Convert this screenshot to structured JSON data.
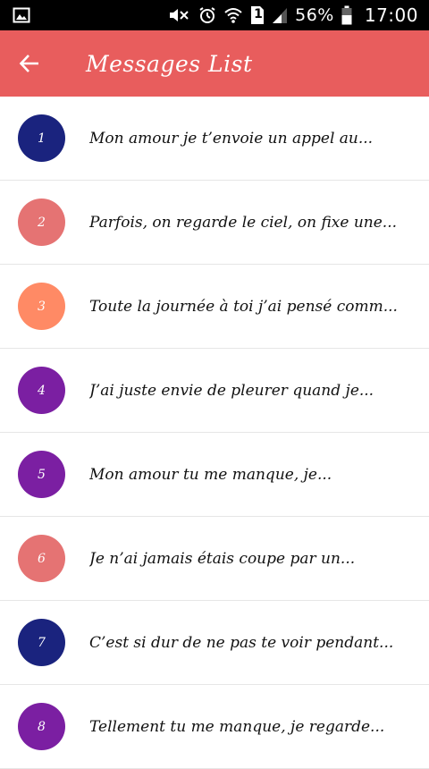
{
  "status_bar": {
    "battery_percent": "56%",
    "time": "17:00",
    "sim_label": "1",
    "icons": [
      "image-icon",
      "mute-icon",
      "alarm-icon",
      "wifi-icon",
      "sim-icon",
      "signal-icon",
      "battery-icon"
    ]
  },
  "app_bar": {
    "title": "Messages List",
    "back_icon": "arrow-left-icon",
    "color": "#e85d5d"
  },
  "messages": [
    {
      "number": "1",
      "text": "Mon amour je t’envoie un appel au...",
      "color": "#1a237e"
    },
    {
      "number": "2",
      "text": "Parfois, on regarde le ciel, on fixe une...",
      "color": "#e57373"
    },
    {
      "number": "3",
      "text": "Toute la journée à toi j’ai pensé comm...",
      "color": "#ff8a65"
    },
    {
      "number": "4",
      "text": "J’ai juste envie de pleurer quand je...",
      "color": "#7b1fa2"
    },
    {
      "number": "5",
      "text": "Mon amour tu me manque, je...",
      "color": "#7b1fa2"
    },
    {
      "number": "6",
      "text": "Je n’ai jamais étais coupe par un...",
      "color": "#e57373"
    },
    {
      "number": "7",
      "text": "C’est si dur de ne pas te voir pendant...",
      "color": "#1a237e"
    },
    {
      "number": "8",
      "text": "Tellement tu me manque, je regarde...",
      "color": "#7b1fa2"
    }
  ]
}
